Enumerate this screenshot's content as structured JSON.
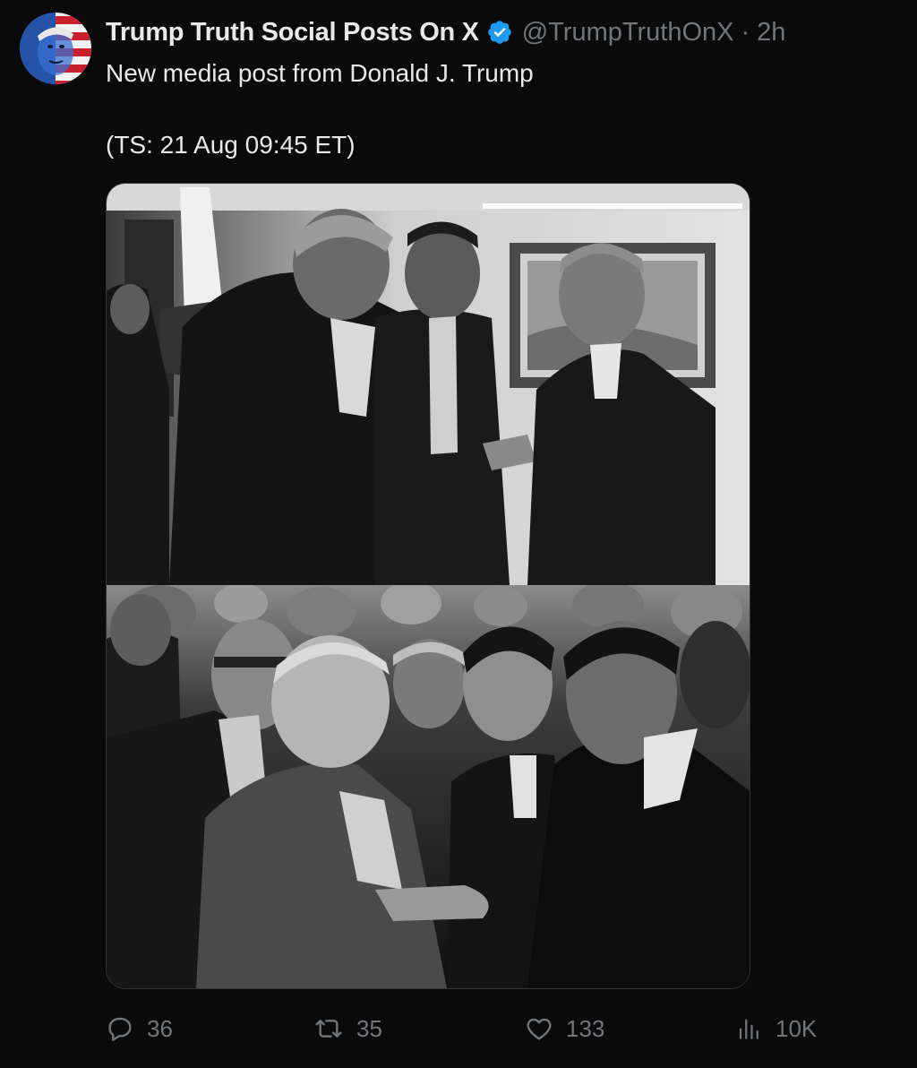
{
  "account": {
    "display_name": "Trump Truth Social Posts On X",
    "verified": true,
    "handle": "@TrumpTruthOnX",
    "separator": "·",
    "time_ago": "2h",
    "avatar": "flag-face-avatar"
  },
  "post": {
    "line1": "New media post from Donald J. Trump",
    "line2": "(TS: 21 Aug 09:45 ET)"
  },
  "media": {
    "photos": [
      {
        "name": "photo-top",
        "tone": "grayscale"
      },
      {
        "name": "photo-bottom",
        "tone": "grayscale"
      }
    ]
  },
  "actions": {
    "reply": {
      "icon": "reply-icon",
      "count": "36"
    },
    "retweet": {
      "icon": "retweet-icon",
      "count": "35"
    },
    "like": {
      "icon": "heart-icon",
      "count": "133"
    },
    "views": {
      "icon": "views-icon",
      "count": "10K"
    }
  },
  "colors": {
    "background": "#0a0a0a",
    "text_primary": "#e7e9ea",
    "text_secondary": "#71767b",
    "verified_blue": "#1d9bf0",
    "border": "#2f3336"
  }
}
